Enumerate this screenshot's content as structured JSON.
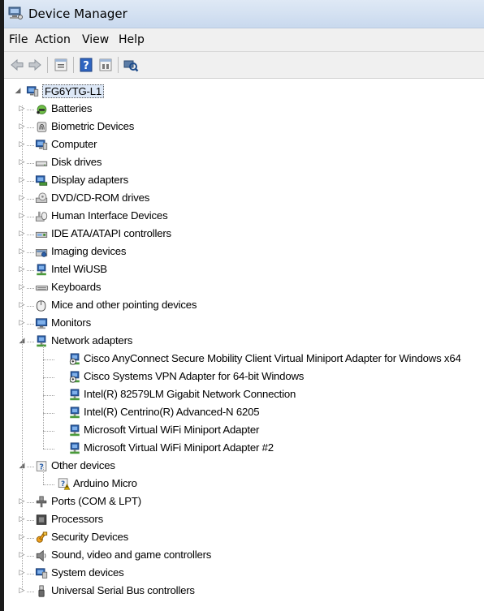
{
  "window": {
    "title": "Device Manager"
  },
  "menu": [
    "File",
    "Action",
    "View",
    "Help"
  ],
  "toolbar": {
    "buttons": [
      "back-arrow-icon",
      "forward-arrow-icon",
      "properties-icon",
      "help-icon",
      "view-icon",
      "scan-hardware-icon"
    ]
  },
  "tree": {
    "root": "FG6YTG-L1",
    "categories": [
      {
        "label": "Batteries",
        "icon": "battery-icon",
        "expanded": false
      },
      {
        "label": "Biometric Devices",
        "icon": "fingerprint-icon",
        "expanded": false
      },
      {
        "label": "Computer",
        "icon": "computer-icon",
        "expanded": false
      },
      {
        "label": "Disk drives",
        "icon": "disk-drive-icon",
        "expanded": false
      },
      {
        "label": "Display adapters",
        "icon": "display-adapter-icon",
        "expanded": false
      },
      {
        "label": "DVD/CD-ROM drives",
        "icon": "dvd-drive-icon",
        "expanded": false
      },
      {
        "label": "Human Interface Devices",
        "icon": "hid-icon",
        "expanded": false
      },
      {
        "label": "IDE ATA/ATAPI controllers",
        "icon": "ide-controller-icon",
        "expanded": false
      },
      {
        "label": "Imaging devices",
        "icon": "imaging-device-icon",
        "expanded": false
      },
      {
        "label": "Intel WiUSB",
        "icon": "network-icon",
        "expanded": false
      },
      {
        "label": "Keyboards",
        "icon": "keyboard-icon",
        "expanded": false
      },
      {
        "label": "Mice and other pointing devices",
        "icon": "mouse-icon",
        "expanded": false
      },
      {
        "label": "Monitors",
        "icon": "monitor-icon",
        "expanded": false
      },
      {
        "label": "Network adapters",
        "icon": "network-adapter-icon",
        "expanded": true,
        "children": [
          {
            "label": "Cisco AnyConnect Secure Mobility Client Virtual Miniport Adapter for Windows x64",
            "icon": "network-adapter-disabled-icon"
          },
          {
            "label": "Cisco Systems VPN Adapter for 64-bit Windows",
            "icon": "network-adapter-disabled-icon"
          },
          {
            "label": "Intel(R) 82579LM Gigabit Network Connection",
            "icon": "network-adapter-icon"
          },
          {
            "label": "Intel(R) Centrino(R) Advanced-N 6205",
            "icon": "network-adapter-icon"
          },
          {
            "label": "Microsoft Virtual WiFi Miniport Adapter",
            "icon": "network-adapter-icon"
          },
          {
            "label": "Microsoft Virtual WiFi Miniport Adapter #2",
            "icon": "network-adapter-icon"
          }
        ]
      },
      {
        "label": "Other devices",
        "icon": "unknown-device-icon",
        "expanded": true,
        "children": [
          {
            "label": "Arduino Micro",
            "icon": "warning-device-icon"
          }
        ]
      },
      {
        "label": "Ports (COM & LPT)",
        "icon": "port-icon",
        "expanded": false
      },
      {
        "label": "Processors",
        "icon": "processor-icon",
        "expanded": false
      },
      {
        "label": "Security Devices",
        "icon": "security-key-icon",
        "expanded": false
      },
      {
        "label": "Sound, video and game controllers",
        "icon": "speaker-icon",
        "expanded": false
      },
      {
        "label": "System devices",
        "icon": "system-device-icon",
        "expanded": false
      },
      {
        "label": "Universal Serial Bus controllers",
        "icon": "usb-icon",
        "expanded": false
      }
    ]
  },
  "colors": {
    "titlebar": "#c9d9ee",
    "menubar": "#f0f0f0",
    "selection": "#dde8f7"
  }
}
